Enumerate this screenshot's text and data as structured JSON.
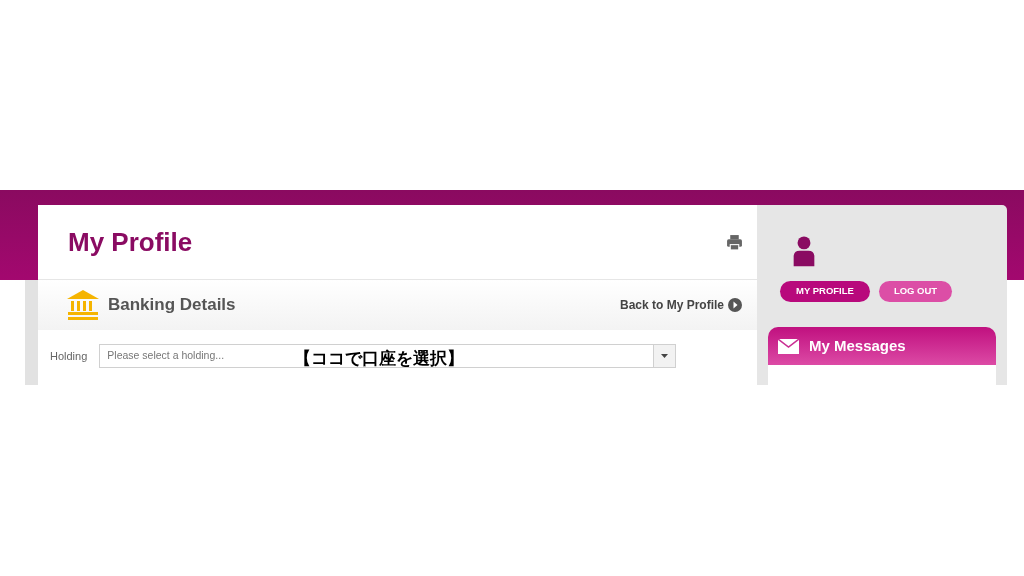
{
  "page_title": "My Profile",
  "section": {
    "title": "Banking Details",
    "back_link": "Back to My Profile"
  },
  "holding": {
    "label": "Holding",
    "placeholder": "Please select a holding...",
    "annotation": "【ココで口座を選択】"
  },
  "nav_buttons": [
    {
      "label": "MY PROFILE",
      "selected": true
    },
    {
      "label": "LOG OUT",
      "selected": false
    }
  ],
  "messages": {
    "title": "My Messages"
  }
}
